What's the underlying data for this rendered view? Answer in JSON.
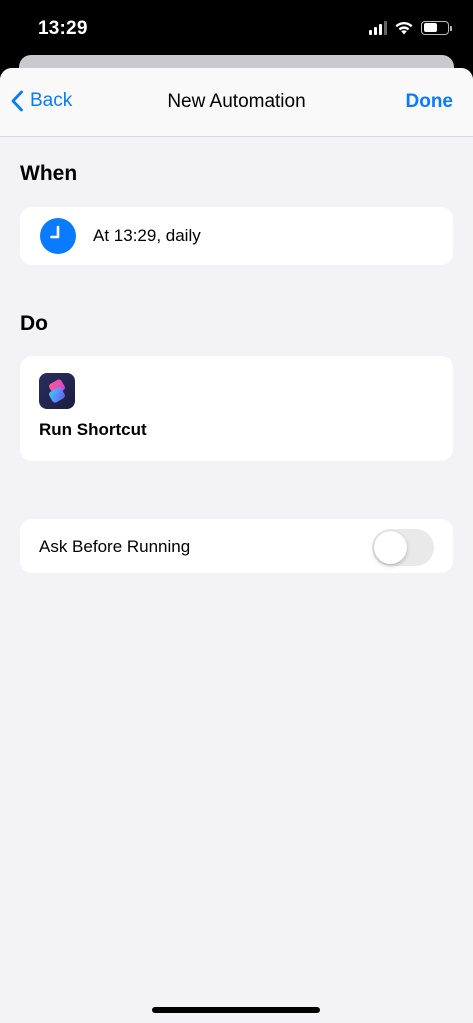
{
  "status_bar": {
    "time": "13:29",
    "icons": [
      "cellular-signal-icon",
      "wifi-icon",
      "battery-icon"
    ]
  },
  "nav": {
    "back_label": "Back",
    "title": "New Automation",
    "done_label": "Done",
    "accent_color": "#0a7aff"
  },
  "when": {
    "header": "When",
    "trigger_text": "At 13:29, daily",
    "icon": "clock-icon"
  },
  "do": {
    "header": "Do",
    "action_label": "Run Shortcut",
    "icon": "shortcuts-app-icon"
  },
  "ask_before_running": {
    "label": "Ask Before Running",
    "enabled": false
  }
}
